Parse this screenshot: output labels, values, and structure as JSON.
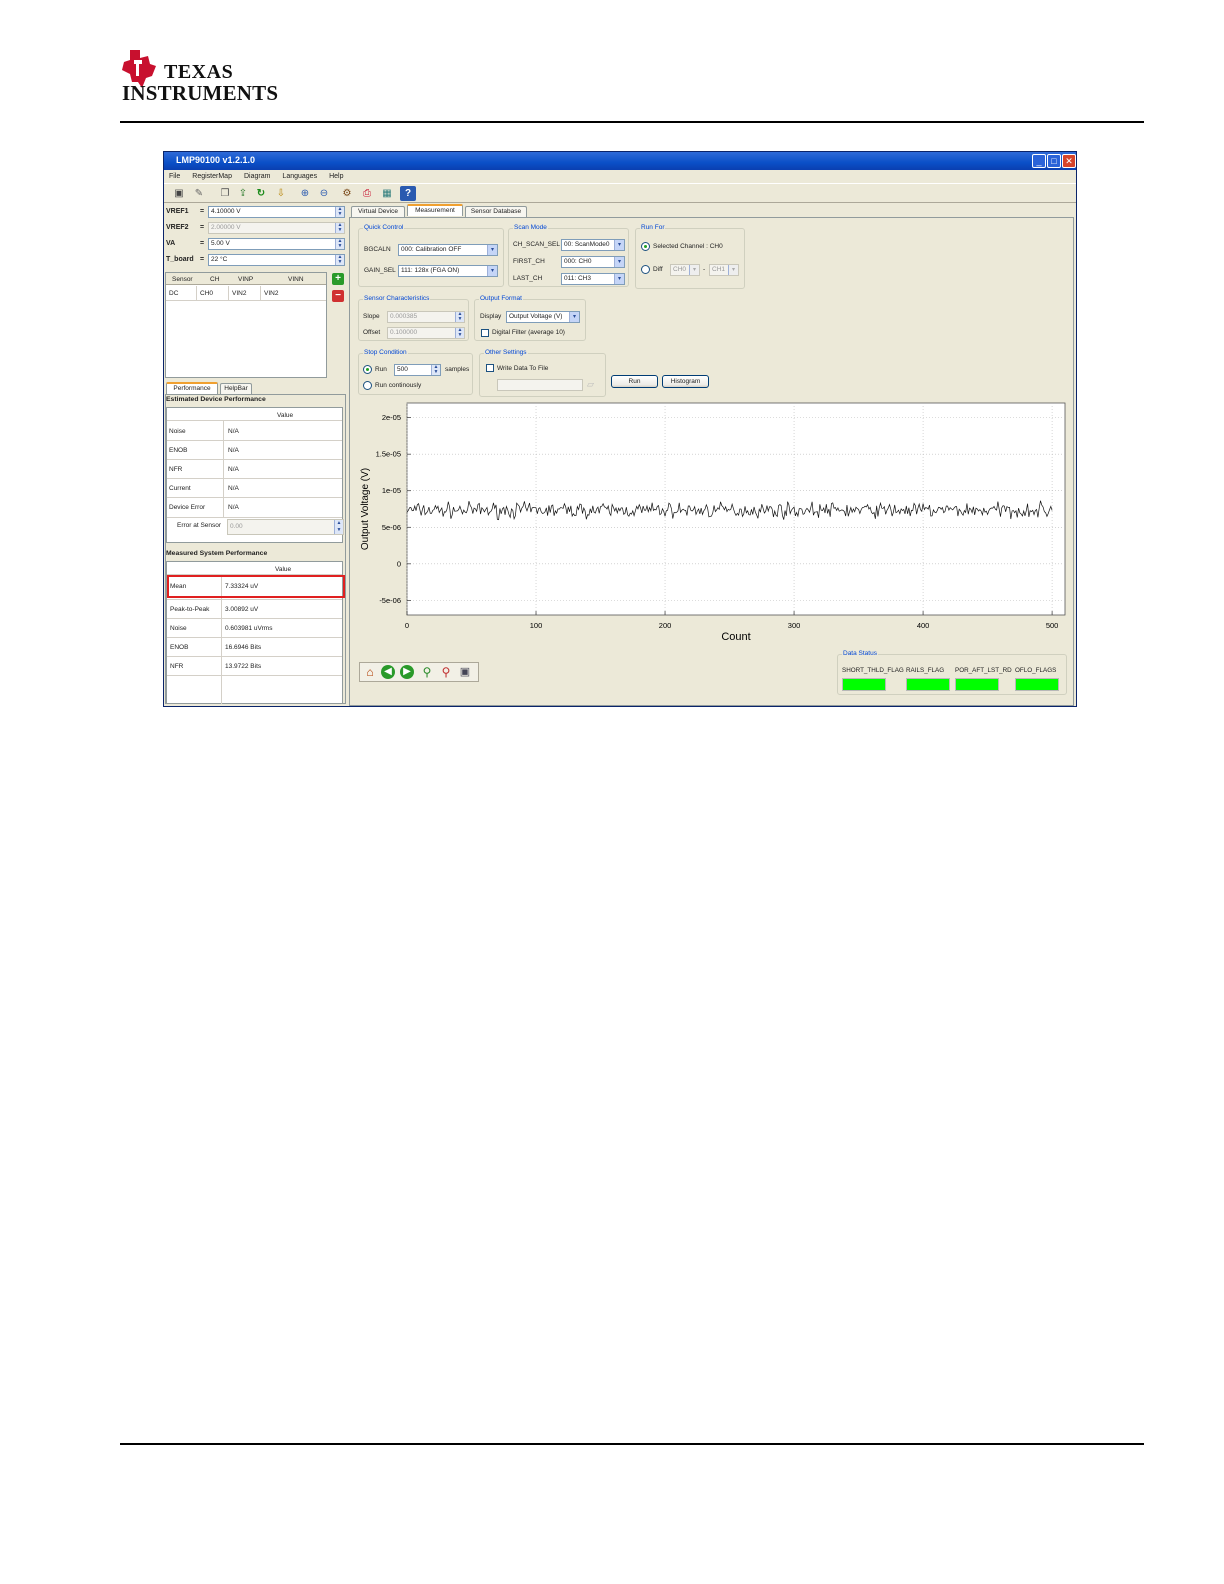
{
  "page": {
    "logo_line1": "Texas",
    "logo_line2": "Instruments"
  },
  "window": {
    "title": "LMP90100 v1.2.1.0",
    "menu": [
      "File",
      "RegisterMap",
      "Diagram",
      "Languages",
      "Help"
    ]
  },
  "left": {
    "vref1_label": "VREF1",
    "vref1_value": "4.10000 V",
    "vref2_label": "VREF2",
    "vref2_value": "2.00000 V",
    "va_label": "VA",
    "va_value": "5.00 V",
    "tboard_label": "T_board",
    "tboard_value": "22 °C",
    "eq": "=",
    "sensor_headers": [
      "Sensor",
      "CH",
      "VINP",
      "VINN"
    ],
    "sensor_row": [
      "DC",
      "CH0",
      "VIN2",
      "VIN2"
    ],
    "tabs": [
      "Performance",
      "HelpBar"
    ],
    "est_title": "Estimated Device Performance",
    "value_header": "Value",
    "est_rows": [
      {
        "label": "Noise",
        "value": "N/A"
      },
      {
        "label": "ENOB",
        "value": "N/A"
      },
      {
        "label": "NFR",
        "value": "N/A"
      },
      {
        "label": "Current",
        "value": "N/A"
      },
      {
        "label": "Device Error",
        "value": "N/A"
      }
    ],
    "error_at_sensor_label": "Error at Sensor",
    "error_at_sensor_value": "0.00",
    "meas_title": "Measured System Performance",
    "meas_rows": [
      {
        "label": "Mean",
        "value": "7.33324 uV"
      },
      {
        "label": "Peak-to-Peak",
        "value": "3.00892 uV"
      },
      {
        "label": "Noise",
        "value": "0.603981 uVrms"
      },
      {
        "label": "ENOB",
        "value": "16.6946 Bits"
      },
      {
        "label": "NFR",
        "value": "13.9722 Bits"
      }
    ]
  },
  "main": {
    "tabs": [
      "Virtual Device",
      "Measurement",
      "Sensor Database"
    ],
    "quick_control": {
      "title": "Quick Control",
      "bgcaln_label": "BGCALN",
      "bgcaln_value": "000: Calibration OFF",
      "gain_label": "GAIN_SEL",
      "gain_value": "111: 128x (FGA ON)"
    },
    "scan_mode": {
      "title": "Scan Mode",
      "ch_scan_label": "CH_SCAN_SEL",
      "ch_scan_value": "00: ScanMode0",
      "first_label": "FIRST_CH",
      "first_value": "000: CH0",
      "last_label": "LAST_CH",
      "last_value": "011: CH3"
    },
    "run_for": {
      "title": "Run For",
      "selected_label": "Selected Channel : CH0",
      "diff_label": "Diff",
      "diff_a": "CH0",
      "diff_sep": "-",
      "diff_b": "CH1"
    },
    "sensor_char": {
      "title": "Sensor Characteristics",
      "slope_label": "Slope",
      "slope_value": "0.000385",
      "offset_label": "Offset",
      "offset_value": "0.100000"
    },
    "output_format": {
      "title": "Output Format",
      "display_label": "Display",
      "display_value": "Output Voltage (V)",
      "filter_label": "Digital Filter (average 10)"
    },
    "stop_condition": {
      "title": "Stop Condition",
      "run_label": "Run",
      "run_value": "500",
      "samples_label": "samples",
      "continuous_label": "Run continously"
    },
    "other_settings": {
      "title": "Other Settings",
      "write_label": "Write Data To File"
    },
    "run_button": "Run",
    "histogram_button": "Histogram",
    "data_status": {
      "title": "Data Status",
      "flags": [
        "SHORT_THLD_FLAG",
        "RAILS_FLAG",
        "POR_AFT_LST_RD",
        "OFLO_FLAGS"
      ]
    }
  },
  "chart_data": {
    "type": "line",
    "xlabel": "Count",
    "ylabel": "Output Voltage (V)",
    "xlim": [
      0,
      510
    ],
    "ylim": [
      -7e-06,
      2.2e-05
    ],
    "x_ticks": [
      "0",
      "100",
      "200",
      "300",
      "400",
      "500"
    ],
    "y_ticks": [
      "2e-05",
      "1.5e-05",
      "1e-05",
      "5e-06",
      "0",
      "-5e-06"
    ],
    "series": [
      {
        "x_start": 0,
        "x_end": 500,
        "points": 500,
        "mean": 7.33324e-06,
        "peak_to_peak": 3.00892e-06
      }
    ]
  }
}
